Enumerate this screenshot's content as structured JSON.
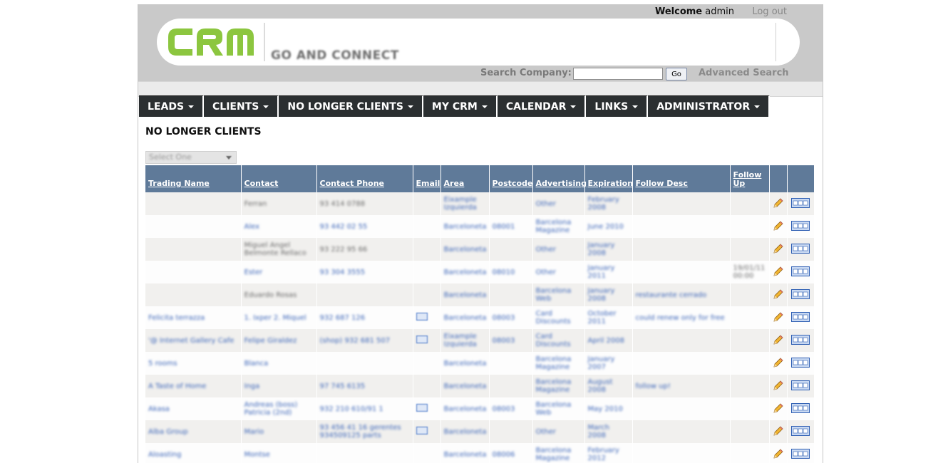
{
  "header": {
    "welcome_label": "Welcome",
    "username": "admin",
    "logout": "Log out",
    "logo_text": "CRM",
    "tagline": "GO AND CONNECT",
    "search_label": "Search Company:",
    "search_value": "",
    "go_button": "Go",
    "advanced_search": "Advanced Search",
    "brand_color": "#8cc63f"
  },
  "nav": [
    {
      "label": "LEADS"
    },
    {
      "label": "CLIENTS"
    },
    {
      "label": "NO LONGER CLIENTS"
    },
    {
      "label": "MY CRM"
    },
    {
      "label": "CALENDAR"
    },
    {
      "label": "LINKS"
    },
    {
      "label": "ADMINISTRATOR"
    }
  ],
  "page_title": "NO LONGER CLIENTS",
  "filter_select": "Select One",
  "table": {
    "columns": [
      "Trading Name",
      "Contact",
      "Contact Phone",
      "Email",
      "Area",
      "Postcode",
      "Advertising",
      "Expiration",
      "Follow Desc",
      "Follow Up"
    ],
    "rows": [
      {
        "trading": "",
        "contact": "Ferran",
        "phone": "93 414 0788",
        "email": false,
        "area": "Eixample Izquierda",
        "postcode": "",
        "adv": "Other",
        "exp": "February 2008",
        "desc": "",
        "follow": ""
      },
      {
        "trading": "",
        "contact": "Alex",
        "phone": "93 442 02 55",
        "email": false,
        "area": "Barceloneta",
        "postcode": "08001",
        "adv": "Barcelona Magazine",
        "exp": "June 2010",
        "desc": "",
        "follow": ""
      },
      {
        "trading": "",
        "contact": "Miguel Angel Belmonte Rellaco",
        "phone": "93 222 95 66",
        "email": false,
        "area": "Barceloneta",
        "postcode": "",
        "adv": "Other",
        "exp": "January 2008",
        "desc": "",
        "follow": ""
      },
      {
        "trading": "",
        "contact": "Ester",
        "phone": "93 304 3555",
        "email": false,
        "area": "Barceloneta",
        "postcode": "08010",
        "adv": "Other",
        "exp": "January 2011",
        "desc": "",
        "follow": "19/01/11 00:00"
      },
      {
        "trading": "",
        "contact": "Eduardo Rosas",
        "phone": "",
        "email": false,
        "area": "Barceloneta",
        "postcode": "",
        "adv": "Barcelona Web",
        "exp": "January 2008",
        "desc": "restaurante cerrado",
        "follow": ""
      },
      {
        "trading": "Felicita terrazza",
        "contact": "1. Ixper 2. Miquel",
        "phone": "932 687 126",
        "email": true,
        "area": "Barceloneta",
        "postcode": "08003",
        "adv": "Card Discounts",
        "exp": "October 2011",
        "desc": "could renew only for free",
        "follow": ""
      },
      {
        "trading": "'@ Internet Gallery Cafe",
        "contact": "Felipe Giraldez",
        "phone": "(shop) 932 681 507",
        "email": true,
        "area": "Eixample Izquierda",
        "postcode": "08003",
        "adv": "Card Discounts",
        "exp": "April 2008",
        "desc": "",
        "follow": ""
      },
      {
        "trading": "5 rooms",
        "contact": "Blanca",
        "phone": "",
        "email": false,
        "area": "Barceloneta",
        "postcode": "",
        "adv": "Barcelona Magazine",
        "exp": "January 2007",
        "desc": "",
        "follow": ""
      },
      {
        "trading": "A Taste of Home",
        "contact": "Inga",
        "phone": "97 745 6135",
        "email": false,
        "area": "Barceloneta",
        "postcode": "",
        "adv": "Barcelona Magazine",
        "exp": "August 2008",
        "desc": "follow up!",
        "follow": ""
      },
      {
        "trading": "Akasa",
        "contact": "Andreas (boss) Patricia (2nd)",
        "phone": "932 210 610/91 1",
        "email": true,
        "area": "Barceloneta",
        "postcode": "08003",
        "adv": "Barcelona Web",
        "exp": "May 2010",
        "desc": "",
        "follow": ""
      },
      {
        "trading": "Alba Group",
        "contact": "Mario",
        "phone": "93 456 41 16 gerentes 934509125 parts",
        "email": true,
        "area": "Barceloneta",
        "postcode": "",
        "adv": "Other",
        "exp": "March 2008",
        "desc": "",
        "follow": ""
      },
      {
        "trading": "Aloasting",
        "contact": "Montse",
        "phone": "",
        "email": false,
        "area": "Barceloneta",
        "postcode": "08006",
        "adv": "Barcelona Magazine",
        "exp": "February 2012",
        "desc": "",
        "follow": ""
      }
    ]
  },
  "colors": {
    "nav_bg": "#2b2f31",
    "table_header_bg": "#5f7a99",
    "header_bg": "#c9c9c9",
    "link": "#3a64b8"
  },
  "icons": {
    "edit": "pencil-icon",
    "view": "card-icon",
    "email": "envelope-icon"
  }
}
